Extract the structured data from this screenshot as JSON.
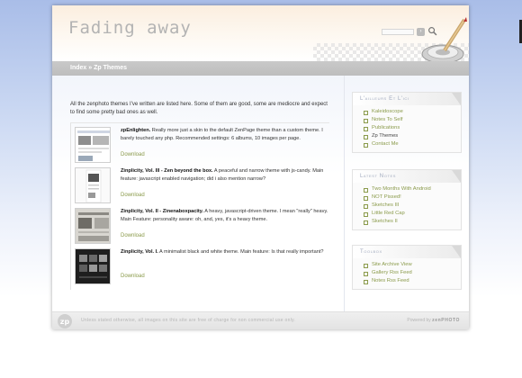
{
  "header": {
    "site_title": "Fading away"
  },
  "breadcrumb": {
    "index": "Index",
    "separator": " » ",
    "current": "Zp Themes"
  },
  "main": {
    "intro": "All the zenphoto themes I've written are listed here. Some of them are good, some are mediocre and expect to find some pretty bad ones as well.",
    "themes": [
      {
        "title": "zpEnlighten.",
        "description": " Really more just a skin to the default ZenPage theme than a custom theme. I barely touched any php. Recommended settings: 6 albums, 10 images per page.",
        "download": "Download"
      },
      {
        "title": "Zinplicity, Vol. III - Zen beyond the box.",
        "description": " A peaceful and narrow theme with js-candy. Main feature: javascript enabled navigation; did i also mention narrow?",
        "download": "Download"
      },
      {
        "title": "Zinplicity, Vol. II - Zinenaboxpacity.",
        "description": " A heavy, javascript-driven theme. I mean \"really\" heavy. Main Feature: personality aware: oh, and, yes, it's a heavy theme.",
        "download": "Download"
      },
      {
        "title": "Zinplicity, Vol. I.",
        "description": " A minimalist black and white theme. Main feature: Is that really important?",
        "download": "Download"
      }
    ]
  },
  "sidebar": {
    "boxes": [
      {
        "title": "L'ailleurs Et L'ici",
        "items": [
          "Kaleidoscope",
          "Notes To Self",
          "Publications",
          "Zp Themes",
          "Contact Me"
        ],
        "current_index": 3
      },
      {
        "title": "Latest Notes",
        "items": [
          "Two Months With Android",
          "NOT Pissed!",
          "Sketches III",
          "Little Red Cap",
          "Sketches II"
        ]
      },
      {
        "title": "Toolbox",
        "items": [
          "Site Archive View",
          "Gallery Rss Feed",
          "Notes Rss Feed"
        ]
      }
    ]
  },
  "footer": {
    "note": "Unless stated otherwise, all images on this site are free of charge for non commercial use only.",
    "powered_prefix": "Powered by ",
    "powered_brand": "zenPHOTO"
  },
  "colors": {
    "link": "#8a9a4a",
    "crumb_bar": "#c4c4c4",
    "sidebar_title": "#a0a9bd"
  }
}
